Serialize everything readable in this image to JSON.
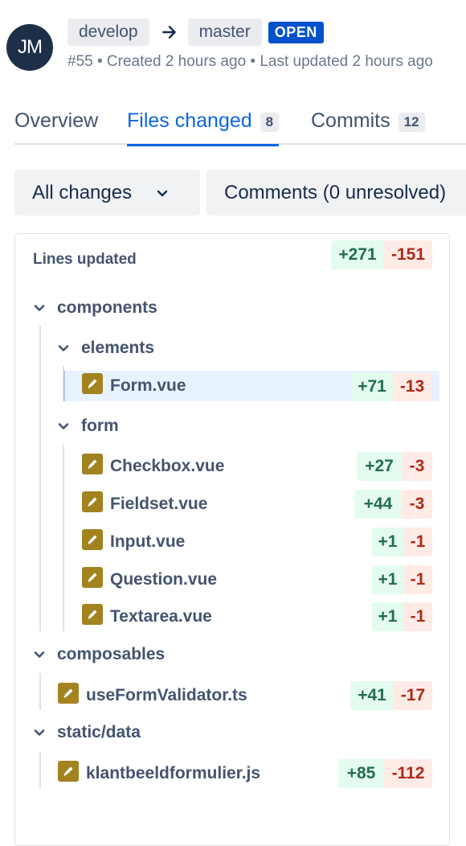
{
  "header": {
    "avatar_initials": "JM",
    "source_branch": "develop",
    "target_branch": "master",
    "status": "OPEN",
    "meta": "#55 • Created 2 hours ago • Last updated 2 hours ago"
  },
  "tabs": [
    {
      "label": "Overview",
      "count": null
    },
    {
      "label": "Files changed",
      "count": "8"
    },
    {
      "label": "Commits",
      "count": "12"
    }
  ],
  "filters": {
    "changes": "All changes",
    "comments": "Comments (0 unresolved)"
  },
  "summary": {
    "title": "Lines updated",
    "added": "+271",
    "removed": "-151"
  },
  "folders": {
    "components": "components",
    "elements": "elements",
    "form": "form",
    "composables": "composables",
    "static_data": "static/data"
  },
  "files": [
    {
      "name": "Form.vue",
      "added": "+71",
      "removed": "-13"
    },
    {
      "name": "Checkbox.vue",
      "added": "+27",
      "removed": "-3"
    },
    {
      "name": "Fieldset.vue",
      "added": "+44",
      "removed": "-3"
    },
    {
      "name": "Input.vue",
      "added": "+1",
      "removed": "-1"
    },
    {
      "name": "Question.vue",
      "added": "+1",
      "removed": "-1"
    },
    {
      "name": "Textarea.vue",
      "added": "+1",
      "removed": "-1"
    },
    {
      "name": "useFormValidator.ts",
      "added": "+41",
      "removed": "-17"
    },
    {
      "name": "klantbeeldformulier.js",
      "added": "+85",
      "removed": "-112"
    }
  ],
  "colors": {
    "accent": "#0c66e4",
    "open_badge": "#0052cc",
    "added_bg": "#e3fcef",
    "removed_bg": "#ffebe6",
    "file_icon": "#a3831f"
  },
  "icons": {
    "arrow": "arrow-right-icon",
    "folder_toggle": "chevron-down-icon",
    "file_modified": "pencil-icon"
  }
}
